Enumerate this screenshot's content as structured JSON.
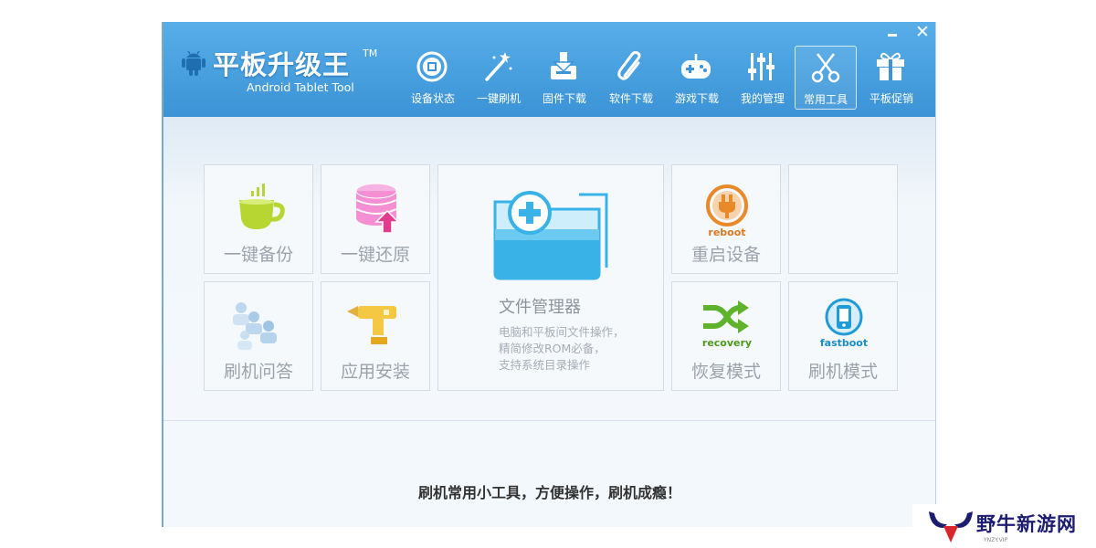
{
  "app": {
    "title": "平板升级王",
    "trademark": "TM",
    "subtitle": "Android Tablet Tool"
  },
  "window_controls": {
    "minimize_icon": "minimize-icon",
    "close_icon": "close-icon",
    "close_glyph": "✕"
  },
  "nav": {
    "active": "常用工具",
    "items": [
      {
        "label": "设备状态",
        "icon": "device-status-icon"
      },
      {
        "label": "一键刷机",
        "icon": "magic-wand-icon"
      },
      {
        "label": "固件下载",
        "icon": "firmware-download-icon"
      },
      {
        "label": "软件下载",
        "icon": "paperclip-icon"
      },
      {
        "label": "游戏下载",
        "icon": "gamepad-icon"
      },
      {
        "label": "我的管理",
        "icon": "sliders-icon"
      },
      {
        "label": "常用工具",
        "icon": "scissors-icon"
      },
      {
        "label": "平板促销",
        "icon": "gift-icon"
      }
    ]
  },
  "tools": {
    "backup": {
      "label": "一键备份",
      "icon": "cup-icon"
    },
    "restore": {
      "label": "一键还原",
      "icon": "database-restore-icon"
    },
    "file_manager": {
      "label": "文件管理器",
      "icon": "folder-add-icon",
      "desc": [
        "电脑和平板间文件操作，",
        "精简修改ROM必备，",
        "支持系统目录操作"
      ]
    },
    "reboot": {
      "label": "重启设备",
      "icon": "power-plug-icon",
      "icon_text": "reboot"
    },
    "empty": {
      "label": ""
    },
    "faq": {
      "label": "刷机问答",
      "icon": "users-icon"
    },
    "install": {
      "label": "应用安装",
      "icon": "drill-icon"
    },
    "recovery": {
      "label": "恢复模式",
      "icon": "shuffle-arrows-icon",
      "icon_text": "recovery"
    },
    "fastboot": {
      "label": "刷机模式",
      "icon": "fastboot-phone-icon",
      "icon_text": "fastboot"
    }
  },
  "footer": {
    "slogan": "刷机常用小工具，方便操作，刷机成瘾！"
  },
  "watermark": {
    "text": "野牛新游网",
    "sub": "YNZY.VIP",
    "icon": "bull-logo-icon"
  },
  "colors": {
    "header_blue": "#3c93d6",
    "cup_green": "#b7d631",
    "restore_pink": "#f48fd4",
    "folder_blue": "#39b2e8",
    "reboot_orange": "#e98a2a",
    "recovery_green": "#5fb32c",
    "fastboot_teal": "#1f9bd8"
  }
}
